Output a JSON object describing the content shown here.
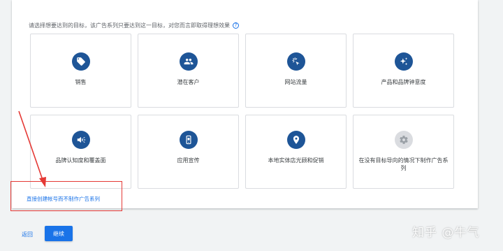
{
  "prompt": {
    "text": "请选择想要达到的目标，该广告系列只要达到这一目标，对您而言即取得理想效果",
    "help_icon": "?"
  },
  "goals": [
    {
      "label": "销售",
      "icon": "tag-icon"
    },
    {
      "label": "潜在客户",
      "icon": "people-icon"
    },
    {
      "label": "网站流量",
      "icon": "cursor-click-icon"
    },
    {
      "label": "产品和品牌钟意度",
      "icon": "sparkle-icon"
    },
    {
      "label": "品牌认知度和覆盖面",
      "icon": "megaphone-icon"
    },
    {
      "label": "应用宣传",
      "icon": "phone-icon"
    },
    {
      "label": "本地实体店光顾和促销",
      "icon": "location-pin-icon"
    },
    {
      "label": "在没有目标导向的情况下制作广告系列",
      "icon": "gear-icon"
    }
  ],
  "links": {
    "direct_create": "直接创建帐号而不制作广告系列"
  },
  "footer": {
    "back_label": "返回",
    "continue_label": "继续"
  },
  "watermark": "知乎 @牛气",
  "colors": {
    "accent": "#1a73e8",
    "icon_circle": "#1e5597",
    "icon_circle_disabled": "#dadce0",
    "annotation_red": "#e53935"
  }
}
